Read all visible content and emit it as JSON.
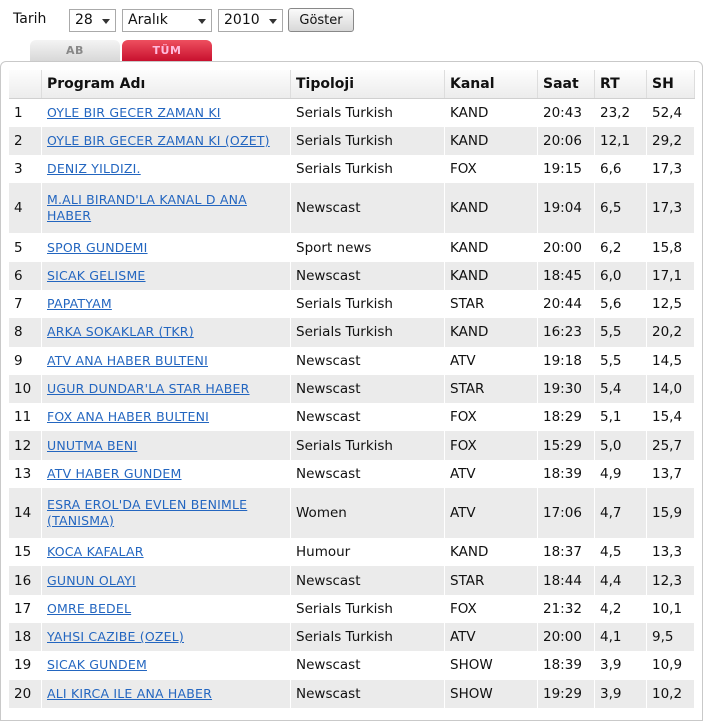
{
  "filter": {
    "label": "Tarih",
    "day": "28",
    "month": "Aralık",
    "year": "2010",
    "submit": "Göster"
  },
  "tabs": [
    "AB",
    "TÜM"
  ],
  "columns": [
    "Program Adı",
    "Tipoloji",
    "Kanal",
    "Saat",
    "RT",
    "SH"
  ],
  "rows": [
    {
      "no": "1",
      "program": "OYLE BIR GECER ZAMAN KI",
      "tip": "Serials Turkish",
      "kanal": "KAND",
      "saat": "20:43",
      "rt": "23,2",
      "sh": "52,4"
    },
    {
      "no": "2",
      "program": "OYLE BIR GECER ZAMAN KI (OZET)",
      "tip": "Serials Turkish",
      "kanal": "KAND",
      "saat": "20:06",
      "rt": "12,1",
      "sh": "29,2"
    },
    {
      "no": "3",
      "program": "DENIZ YILDIZI.",
      "tip": "Serials Turkish",
      "kanal": "FOX",
      "saat": "19:15",
      "rt": "6,6",
      "sh": "17,3"
    },
    {
      "no": "4",
      "program": "M.ALI BIRAND'LA KANAL D ANA HABER",
      "tip": "Newscast",
      "kanal": "KAND",
      "saat": "19:04",
      "rt": "6,5",
      "sh": "17,3"
    },
    {
      "no": "5",
      "program": "SPOR GUNDEMI",
      "tip": "Sport news",
      "kanal": "KAND",
      "saat": "20:00",
      "rt": "6,2",
      "sh": "15,8"
    },
    {
      "no": "6",
      "program": "SICAK GELISME",
      "tip": "Newscast",
      "kanal": "KAND",
      "saat": "18:45",
      "rt": "6,0",
      "sh": "17,1"
    },
    {
      "no": "7",
      "program": "PAPATYAM",
      "tip": "Serials Turkish",
      "kanal": "STAR",
      "saat": "20:44",
      "rt": "5,6",
      "sh": "12,5"
    },
    {
      "no": "8",
      "program": "ARKA SOKAKLAR (TKR)",
      "tip": "Serials Turkish",
      "kanal": "KAND",
      "saat": "16:23",
      "rt": "5,5",
      "sh": "20,2"
    },
    {
      "no": "9",
      "program": "ATV ANA HABER BULTENI",
      "tip": "Newscast",
      "kanal": "ATV",
      "saat": "19:18",
      "rt": "5,5",
      "sh": "14,5"
    },
    {
      "no": "10",
      "program": "UGUR DUNDAR'LA STAR HABER",
      "tip": "Newscast",
      "kanal": "STAR",
      "saat": "19:30",
      "rt": "5,4",
      "sh": "14,0"
    },
    {
      "no": "11",
      "program": "FOX ANA HABER BULTENI",
      "tip": "Newscast",
      "kanal": "FOX",
      "saat": "18:29",
      "rt": "5,1",
      "sh": "15,4"
    },
    {
      "no": "12",
      "program": "UNUTMA BENI",
      "tip": "Serials Turkish",
      "kanal": "FOX",
      "saat": "15:29",
      "rt": "5,0",
      "sh": "25,7"
    },
    {
      "no": "13",
      "program": "ATV HABER GUNDEM",
      "tip": "Newscast",
      "kanal": "ATV",
      "saat": "18:39",
      "rt": "4,9",
      "sh": "13,7"
    },
    {
      "no": "14",
      "program": "ESRA EROL'DA EVLEN BENIMLE (TANISMA)",
      "tip": "Women",
      "kanal": "ATV",
      "saat": "17:06",
      "rt": "4,7",
      "sh": "15,9"
    },
    {
      "no": "15",
      "program": "KOCA KAFALAR",
      "tip": "Humour",
      "kanal": "KAND",
      "saat": "18:37",
      "rt": "4,5",
      "sh": "13,3"
    },
    {
      "no": "16",
      "program": "GUNUN OLAYI",
      "tip": "Newscast",
      "kanal": "STAR",
      "saat": "18:44",
      "rt": "4,4",
      "sh": "12,3"
    },
    {
      "no": "17",
      "program": "OMRE BEDEL",
      "tip": "Serials Turkish",
      "kanal": "FOX",
      "saat": "21:32",
      "rt": "4,2",
      "sh": "10,1"
    },
    {
      "no": "18",
      "program": "YAHSI CAZIBE (OZEL)",
      "tip": "Serials Turkish",
      "kanal": "ATV",
      "saat": "20:00",
      "rt": "4,1",
      "sh": "9,5"
    },
    {
      "no": "19",
      "program": "SICAK GUNDEM",
      "tip": "Newscast",
      "kanal": "SHOW",
      "saat": "18:39",
      "rt": "3,9",
      "sh": "10,9"
    },
    {
      "no": "20",
      "program": "ALI KIRCA ILE ANA HABER",
      "tip": "Newscast",
      "kanal": "SHOW",
      "saat": "19:29",
      "rt": "3,9",
      "sh": "10,2"
    }
  ]
}
